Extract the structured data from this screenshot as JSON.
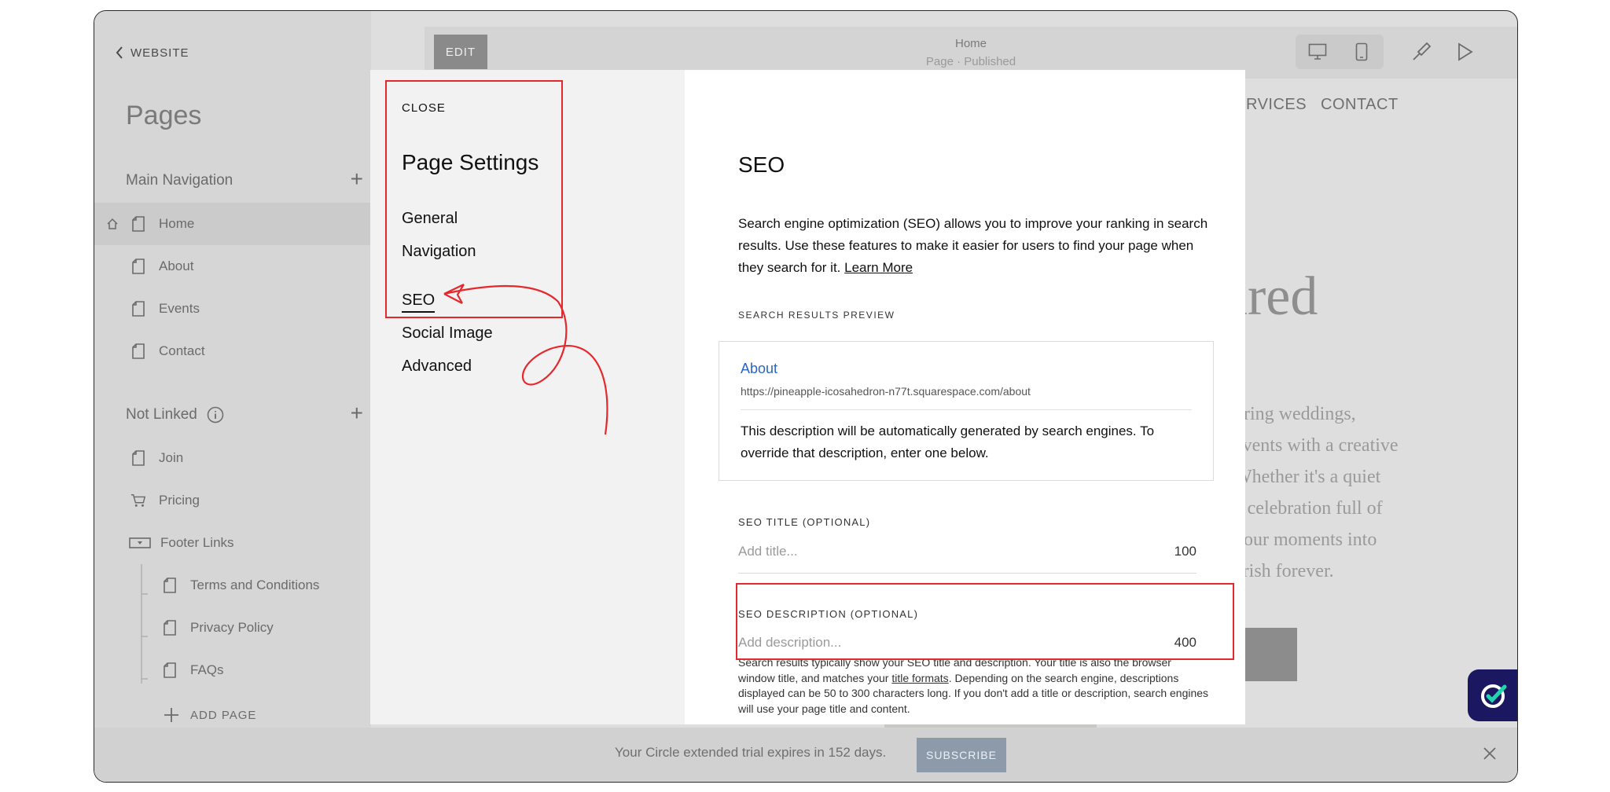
{
  "sidebar": {
    "back_label": "WEBSITE",
    "title": "Pages",
    "main_nav_label": "Main Navigation",
    "main_items": [
      {
        "label": "Home"
      },
      {
        "label": "About"
      },
      {
        "label": "Events"
      },
      {
        "label": "Contact"
      }
    ],
    "not_linked_label": "Not Linked",
    "not_linked_items": [
      {
        "label": "Join"
      },
      {
        "label": "Pricing"
      },
      {
        "label": "Footer Links"
      }
    ],
    "footer_items": [
      {
        "label": "Terms and Conditions"
      },
      {
        "label": "Privacy Policy"
      },
      {
        "label": "FAQs"
      }
    ],
    "add_page_label": "ADD PAGE"
  },
  "topbar": {
    "edit_label": "EDIT",
    "page_name": "Home",
    "page_status": "Page · Published"
  },
  "site": {
    "nav_services": "RVICES",
    "nav_contact": "CONTACT",
    "heading": "ured",
    "para_lines": [
      "uring weddings,",
      "events with a creative",
      "Whether it's a quiet",
      "a celebration full of",
      "your moments into",
      "erish forever."
    ]
  },
  "modal": {
    "close_label": "CLOSE",
    "settings_title": "Page Settings",
    "nav_items": [
      {
        "label": "General"
      },
      {
        "label": "Navigation"
      },
      {
        "label": "SEO"
      },
      {
        "label": "Social Image"
      },
      {
        "label": "Advanced"
      }
    ],
    "seo": {
      "heading": "SEO",
      "description": "Search engine optimization (SEO) allows you to improve your ranking in search results. Use these features to make it easier for users to find your page when they search for it.",
      "learn_more": "Learn More",
      "preview_label": "SEARCH RESULTS PREVIEW",
      "preview_title": "About",
      "preview_url": "https://pineapple-icosahedron-n77t.squarespace.com/about",
      "preview_text": "This description will be automatically generated by search engines. To override that description, enter one below.",
      "title_label": "SEO TITLE (OPTIONAL)",
      "title_placeholder": "Add title...",
      "title_count": "100",
      "desc_label": "SEO DESCRIPTION (OPTIONAL)",
      "desc_placeholder": "Add description...",
      "desc_count": "400",
      "help_part1": "Search results typically show your SEO title and description. Your title is also the browser window title, and matches your",
      "help_link": "title formats",
      "help_part2": ". Depending on the search engine, descriptions displayed can be 50 to 300 characters long. If you don't add a title or description, search engines will use your page title and content."
    }
  },
  "banner": {
    "text": "Your Circle extended trial expires in 152 days.",
    "subscribe_label": "SUBSCRIBE"
  },
  "colors": {
    "annotation_red": "#e5282d",
    "link_blue": "#2a64c9",
    "widget_navy": "#1b1760"
  }
}
